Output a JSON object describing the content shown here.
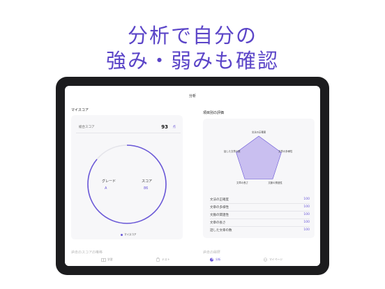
{
  "headline": {
    "line1": "分析で自分の",
    "line2": "強み・弱みも確認"
  },
  "screen": {
    "nav_title": "分析",
    "my_score": {
      "section_title": "マイスコア",
      "total_label": "総合スコア",
      "total_value": "93",
      "total_unit": "点",
      "grade_label": "グレード",
      "grade_value": "A",
      "score_label": "スコア",
      "score_value": "86",
      "score_progress": 0.86,
      "legend": "マイスコア"
    },
    "evaluation": {
      "section_title": "項目別の評価",
      "radar_labels": [
        "文法の正確度",
        "文章の多様性",
        "文脈の関連性",
        "文章の長さ",
        "話した文章の数"
      ],
      "radar_values": [
        100,
        100,
        100,
        100,
        100
      ],
      "metrics": [
        {
          "label": "文法の正確度",
          "value": "100"
        },
        {
          "label": "文章の多様性",
          "value": "100"
        },
        {
          "label": "文脈の関連性",
          "value": "100"
        },
        {
          "label": "文章の長さ",
          "value": "100"
        },
        {
          "label": "話した文章の数",
          "value": "100"
        }
      ]
    },
    "lower_sections": {
      "left": "過去のスコアの推移",
      "right": "過去の履歴"
    },
    "tabs": [
      {
        "label": "学習",
        "icon": "book-icon",
        "active": false
      },
      {
        "label": "テスト",
        "icon": "clipboard-icon",
        "active": false
      },
      {
        "label": "分析",
        "icon": "pie-chart-icon",
        "active": true
      },
      {
        "label": "マイページ",
        "icon": "smile-icon",
        "active": false
      }
    ],
    "colors": {
      "accent": "#6a58d8",
      "radar_fill": "#c9bff0"
    }
  }
}
